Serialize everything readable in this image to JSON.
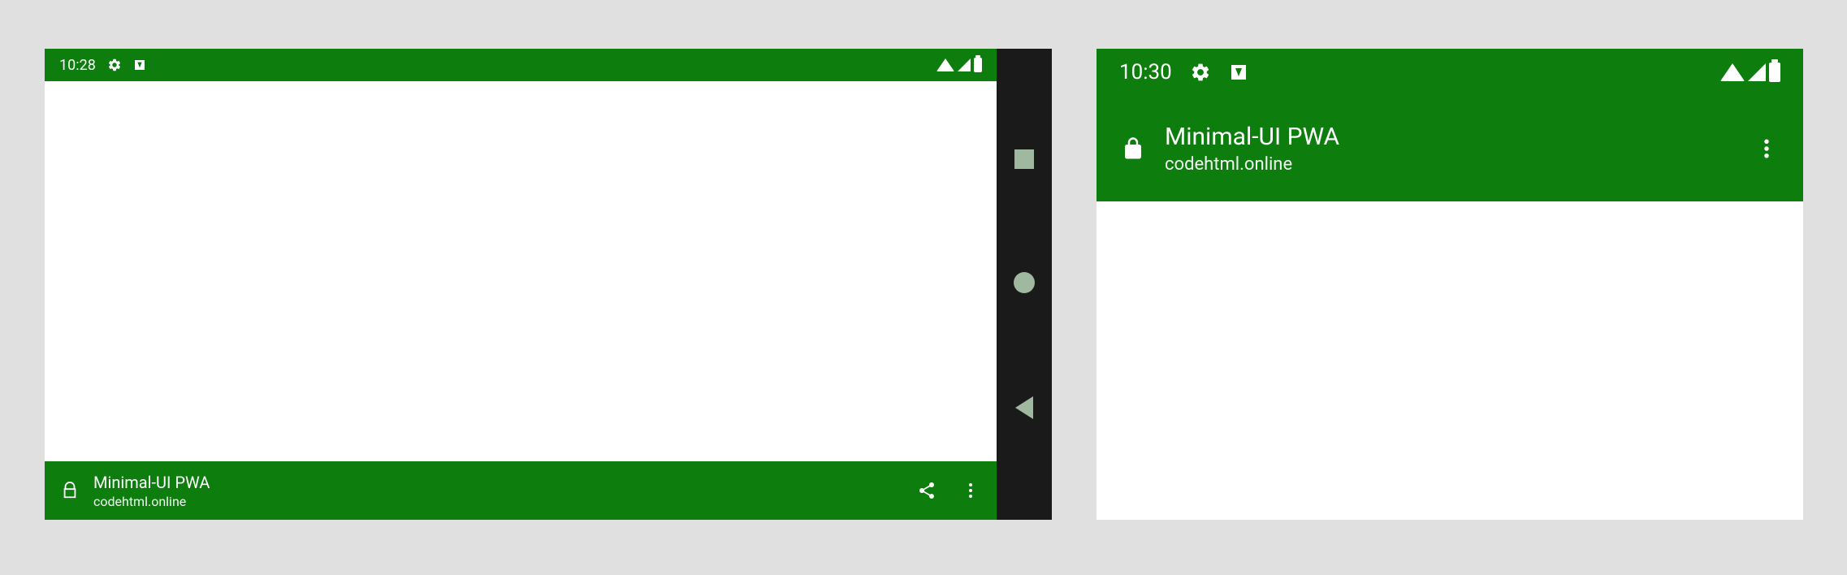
{
  "colors": {
    "theme": "#0d7d0d",
    "nav_bg": "#1a1a1a",
    "nav_icon": "#9fb89f",
    "page_bg": "#e0e0e0"
  },
  "left": {
    "status_time": "10:28",
    "app_title": "Minimal-UI PWA",
    "app_url": "codehtml.online"
  },
  "right": {
    "status_time": "10:30",
    "app_title": "Minimal-UI PWA",
    "app_url": "codehtml.online"
  }
}
